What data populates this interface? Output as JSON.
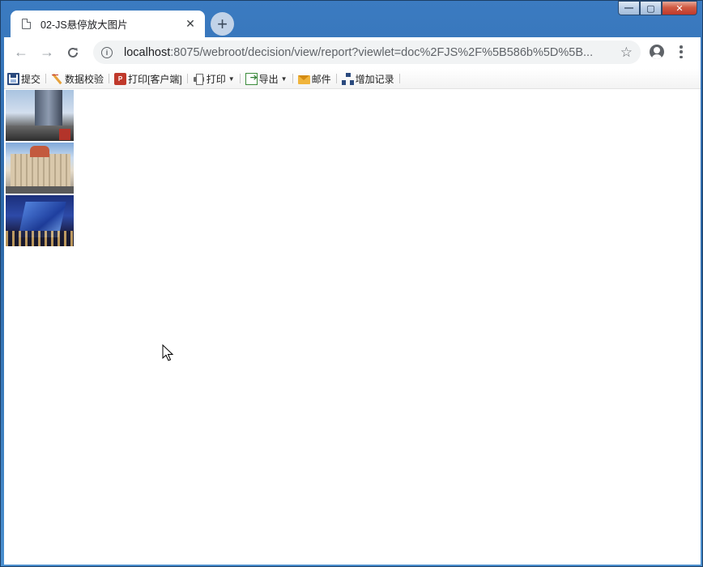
{
  "tab": {
    "title": "02-JS悬停放大图片",
    "close": "✕"
  },
  "new_tab_label": "+",
  "window_controls": {
    "minimize": "—",
    "maximize": "▢",
    "close": "✕"
  },
  "nav": {
    "back": "←",
    "forward": "→",
    "reload": "C"
  },
  "address_bar": {
    "host": "localhost",
    "rest": ":8075/webroot/decision/view/report?viewlet=doc%2FJS%2F%5B586b%5D%5B..."
  },
  "report_toolbar": {
    "items": [
      {
        "label": "提交",
        "icon": "save-icon"
      },
      {
        "label": "数据校验",
        "icon": "validate-icon"
      },
      {
        "label": "打印[客户端]",
        "icon": "pdf-print-icon"
      },
      {
        "label": "打印",
        "icon": "print-icon",
        "dropdown": true
      },
      {
        "label": "导出",
        "icon": "export-icon",
        "dropdown": true
      },
      {
        "label": "邮件",
        "icon": "mail-icon"
      },
      {
        "label": "增加记录",
        "icon": "add-record-icon"
      }
    ],
    "pdf_glyph": "P",
    "caret": "▼"
  },
  "images": [
    {
      "name": "skyscraper-photo"
    },
    {
      "name": "palace-hotel-photo"
    },
    {
      "name": "night-mall-photo"
    }
  ],
  "colors": {
    "window_frame": "#2c68a8",
    "tab_bg": "#ffffff",
    "omnibox_bg": "#f1f3f4",
    "close_button": "#c0392b"
  }
}
